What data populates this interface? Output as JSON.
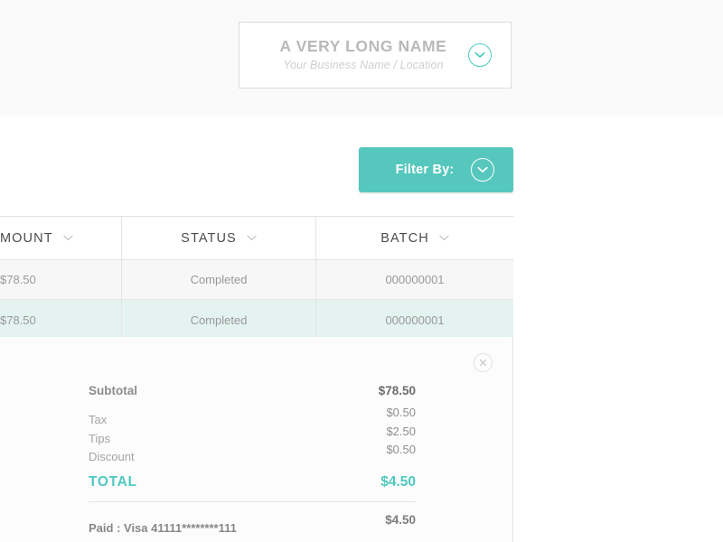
{
  "business_card": {
    "name": "A VERY LONG NAME",
    "subtitle": "Your Business Name / Location",
    "chevron_icon": "chevron-down-icon"
  },
  "filter": {
    "label": "Filter By:",
    "chevron_icon": "chevron-down-icon",
    "color": "#56c7bd"
  },
  "table": {
    "columns": [
      {
        "label": "MOUNT",
        "sort_icon": "chevron-down-icon"
      },
      {
        "label": "STATUS",
        "sort_icon": "chevron-down-icon"
      },
      {
        "label": "BATCH",
        "sort_icon": "chevron-down-icon"
      }
    ],
    "rows": [
      {
        "amount": "$78.50",
        "status": "Completed",
        "batch": "000000001",
        "selected": false
      },
      {
        "amount": "$78.50",
        "status": "Completed",
        "batch": "000000001",
        "selected": true
      }
    ]
  },
  "detail": {
    "close_icon": "close-icon",
    "lines": [
      {
        "label": "Subtotal",
        "amount": "$78.50"
      },
      {
        "label": "Tax",
        "amount": "$0.50"
      },
      {
        "label": "Tips",
        "amount": "$2.50"
      },
      {
        "label": "Discount",
        "amount": "$0.50"
      }
    ],
    "total": {
      "label": "TOTAL",
      "amount": "$4.50",
      "color": "#4ec9c0"
    },
    "paid": {
      "label": "Paid : Visa 41111********111",
      "amount": "$4.50"
    }
  }
}
